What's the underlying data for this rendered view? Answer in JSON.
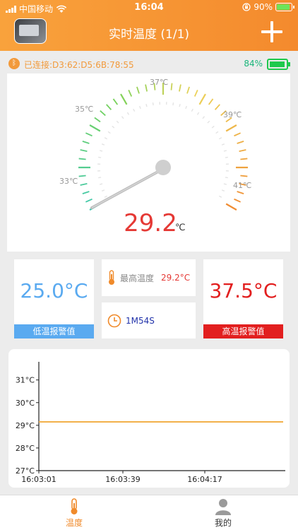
{
  "status_bar": {
    "carrier": "中国移动",
    "time": "16:04",
    "battery": "90%"
  },
  "nav": {
    "title": "实时温度 (1/1)"
  },
  "connection": {
    "text": "已连接:D3:62:D5:6B:78:55",
    "battery_pct": "84%",
    "battery_level": 0.84
  },
  "gauge": {
    "labels": [
      "33℃",
      "35℃",
      "37℃",
      "39℃",
      "41℃"
    ],
    "value": "29.2",
    "unit": "℃",
    "value_color": "#e53935"
  },
  "low_alarm": {
    "value": "25.0°C",
    "label": "低温报警值",
    "color": "#5aaaf0"
  },
  "max_temp": {
    "label": "最高温度",
    "value": "29.2°C"
  },
  "duration": {
    "value": "1M54S"
  },
  "high_alarm": {
    "value": "37.5°C",
    "label": "高温报警值",
    "color": "#e21f1f"
  },
  "chart_data": {
    "type": "line",
    "y_ticks": [
      "31°C",
      "30°C",
      "29°C",
      "28°C",
      "27°C"
    ],
    "x_ticks": [
      "16:03:01",
      "16:03:39",
      "16:04:17"
    ],
    "ylim": [
      27,
      31.8
    ],
    "series": [
      {
        "x": [
          "16:03:01",
          "16:04:55"
        ],
        "values": [
          29.15,
          29.15
        ],
        "color": "#f2b04a"
      }
    ]
  },
  "tabs": [
    {
      "label": "温度",
      "icon": "thermometer-icon",
      "active": true
    },
    {
      "label": "我的",
      "icon": "person-icon",
      "active": false
    }
  ]
}
